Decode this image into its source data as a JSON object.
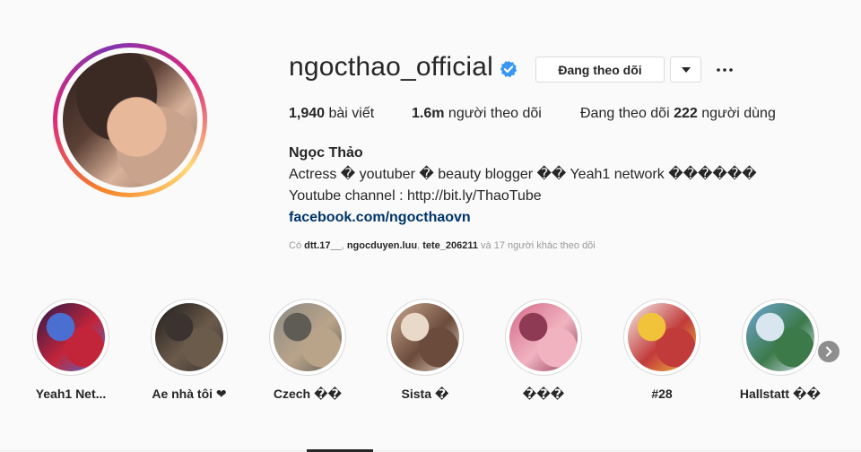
{
  "profile": {
    "username": "ngocthao_official",
    "verified": true,
    "follow_button_label": "Đang theo dõi",
    "stats": {
      "posts_count": "1,940",
      "posts_label": "bài viết",
      "followers_count": "1.6m",
      "followers_label": "người theo dõi",
      "following_prefix": "Đang theo dõi",
      "following_count": "222",
      "following_label": "người dùng"
    },
    "bio": {
      "name": "Ngọc Thảo",
      "line1": "Actress � youtuber � beauty blogger �� Yeah1 network ������",
      "line2": "Youtube channel : http://bit.ly/ThaoTube",
      "link": "facebook.com/ngocthaovn"
    },
    "followed_by": {
      "prefix": "Có",
      "users": [
        "dtt.17__",
        "ngocduyen.luu",
        "tete_206211"
      ],
      "suffix": "và 17 người khác theo dõi"
    }
  },
  "highlights": [
    {
      "label": "Yeah1 Net...",
      "colors": [
        "#2b1a4a",
        "#c2253a",
        "#4a6fd1"
      ]
    },
    {
      "label": "Ae nhà tôi ❤",
      "colors": [
        "#1e1a1a",
        "#6b5b4b",
        "#3a3330"
      ]
    },
    {
      "label": "Czech ��",
      "colors": [
        "#8c8a86",
        "#b9a48a",
        "#5f5b55"
      ]
    },
    {
      "label": "Sista �",
      "colors": [
        "#c9a98f",
        "#6b4b3b",
        "#e9d9c9"
      ]
    },
    {
      "label": "���",
      "colors": [
        "#d46a8a",
        "#f1b3c0",
        "#8e3a55"
      ]
    },
    {
      "label": "#28",
      "colors": [
        "#f5f0ea",
        "#c23b3b",
        "#f1c33a"
      ]
    },
    {
      "label": "Hallstatt ��",
      "colors": [
        "#6fa8d8",
        "#3c7a4a",
        "#d9e6f0"
      ]
    }
  ],
  "icons": {
    "verified": "verified-badge-icon",
    "dropdown": "chevron-down-icon",
    "more": "more-options-icon",
    "next": "chevron-right-icon"
  },
  "colors": {
    "verified_blue": "#3897f0",
    "link_blue": "#003569",
    "muted": "#999999",
    "border": "#dbdbdb"
  }
}
